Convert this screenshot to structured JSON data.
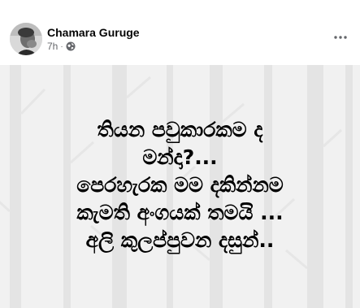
{
  "post": {
    "author": "Chamara Guruge",
    "time": "7h",
    "separator": "·",
    "privacy_icon": "globe-icon",
    "more_icon": "more-horizontal-icon",
    "background": "snowy-forest-pattern",
    "lines": [
      "තියන පවුකාරකම ද",
      "මන්දා?...",
      "පෙරහැරක මම දකින්නම",
      "කැමති අංගයක් තමයි ...",
      "අලි කුලප්පුවන දසුන්.."
    ]
  },
  "colors": {
    "name": "#050505",
    "meta": "#65676b",
    "post_background": "#f2f2f2",
    "post_text": "#000000"
  }
}
